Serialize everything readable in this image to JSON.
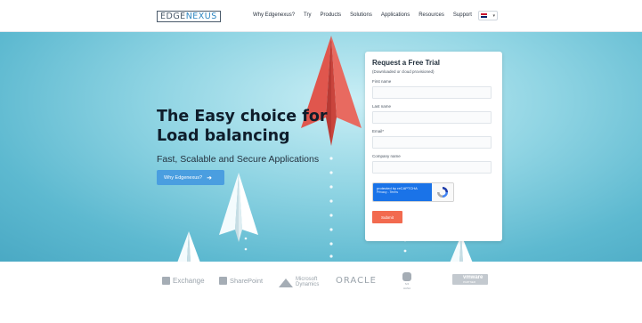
{
  "header": {
    "logo": {
      "part1": "EDGE",
      "part2": "NEXUS"
    },
    "nav": [
      "Why Edgenexus?",
      "Try",
      "Products",
      "Solutions",
      "Applications",
      "Resources",
      "Support"
    ],
    "language": {
      "flag": "uk-flag-icon",
      "caret": "▾"
    }
  },
  "hero": {
    "headline_line1": "The Easy choice for",
    "headline_line2": "Load balancing",
    "subheadline": "Fast, Scalable and Secure Applications",
    "cta_label": "Why Edgenexus?",
    "cta_icon": "arrow-right-icon"
  },
  "form": {
    "title": "Request a Free Trial",
    "subtitle": "(Downloaded or cloud provisioned)",
    "fields": {
      "first_name": "First name",
      "last_name": "Last name",
      "email": "Email*",
      "company": "Company name"
    },
    "recaptcha": {
      "line1": "protected by reCAPTCHA",
      "line2": "Privacy - Terms"
    },
    "submit_label": "Submit"
  },
  "partners": {
    "exchange": "Exchange",
    "sharepoint": "SharePoint",
    "dynamics_line1": "Microsoft",
    "dynamics_line2": "Dynamics",
    "oracle": "ORACLE",
    "s4_line1": "S/4",
    "s4_line2": "HANA",
    "vmware_line1": "vmware",
    "vmware_line2": "PARTNER"
  },
  "colors": {
    "cta": "#4a9ee0",
    "submit": "#f26a4f",
    "plane_red": "#e0564d",
    "hero_bg": "#8fd4e3"
  }
}
